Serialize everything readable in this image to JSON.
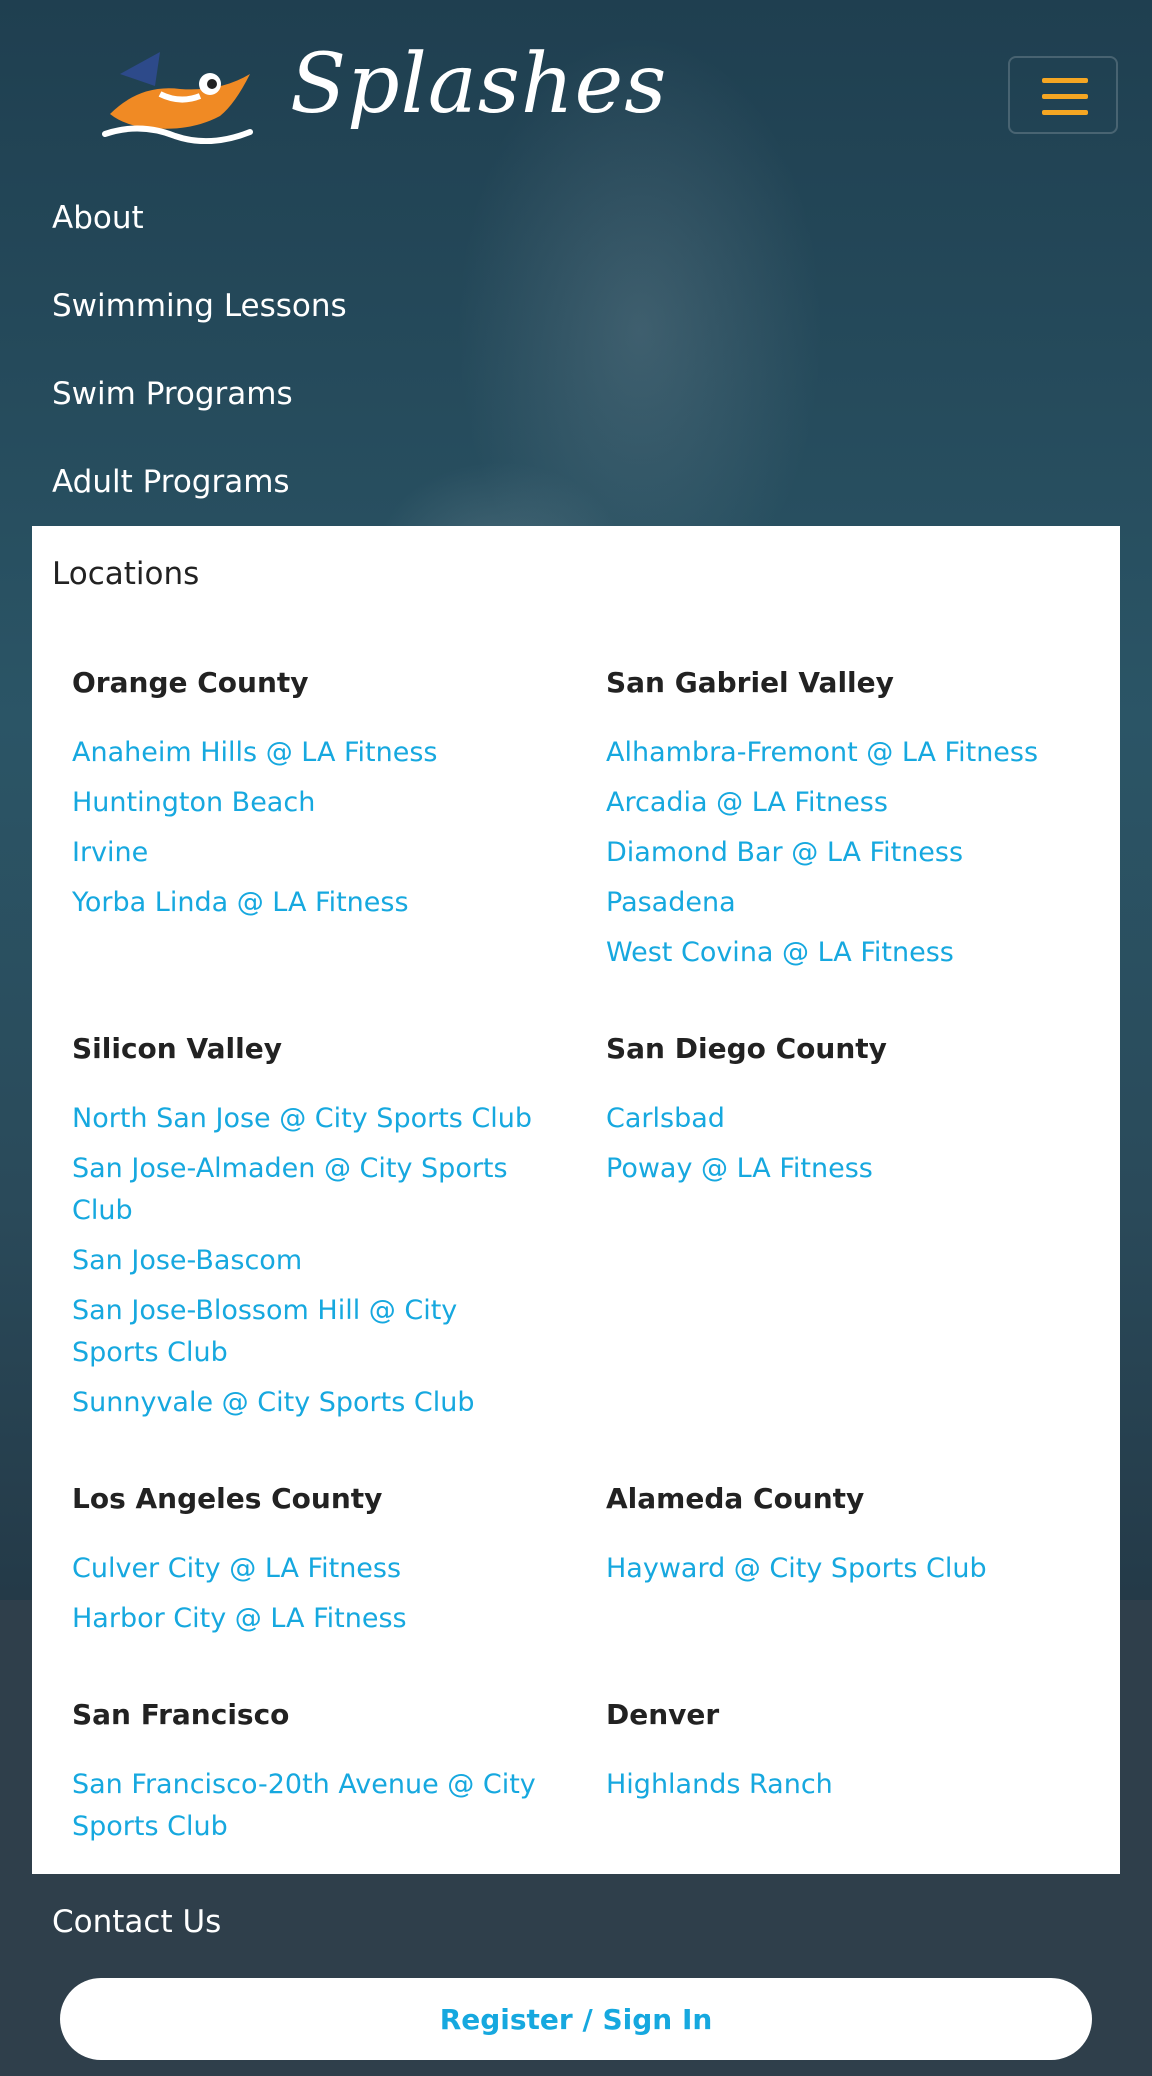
{
  "brand": {
    "name": "Splashes",
    "mascot": "shark-mascot-icon"
  },
  "colors": {
    "accent": "#f5a623",
    "link": "#16a8df"
  },
  "nav": {
    "items": [
      "About",
      "Swimming Lessons",
      "Swim Programs",
      "Adult Programs"
    ],
    "locations_label": "Locations",
    "contact_label": "Contact Us"
  },
  "locations": {
    "groups": [
      {
        "title": "Orange County",
        "links": [
          "Anaheim Hills @ LA Fitness",
          "Huntington Beach",
          "Irvine",
          "Yorba Linda @ LA Fitness"
        ]
      },
      {
        "title": "San Gabriel Valley",
        "links": [
          "Alhambra-Fremont @ LA Fitness",
          "Arcadia @ LA Fitness",
          "Diamond Bar @ LA Fitness",
          "Pasadena",
          "West Covina @ LA Fitness"
        ]
      },
      {
        "title": "Silicon Valley",
        "links": [
          "North San Jose @ City Sports Club",
          "San Jose-Almaden @ City Sports Club",
          "San Jose-Bascom",
          "San Jose-Blossom Hill @ City Sports Club",
          "Sunnyvale @ City Sports Club"
        ]
      },
      {
        "title": "San Diego County",
        "links": [
          "Carlsbad",
          "Poway @ LA Fitness"
        ]
      },
      {
        "title": "Los Angeles County",
        "links": [
          "Culver City @ LA Fitness",
          "Harbor City @ LA Fitness"
        ]
      },
      {
        "title": "Alameda County",
        "links": [
          "Hayward @ City Sports Club"
        ]
      },
      {
        "title": "San Francisco",
        "links": [
          "San Francisco-20th Avenue @ City Sports Club"
        ]
      },
      {
        "title": "Denver",
        "links": [
          "Highlands Ranch"
        ]
      }
    ]
  },
  "register": {
    "label": "Register / Sign In"
  }
}
